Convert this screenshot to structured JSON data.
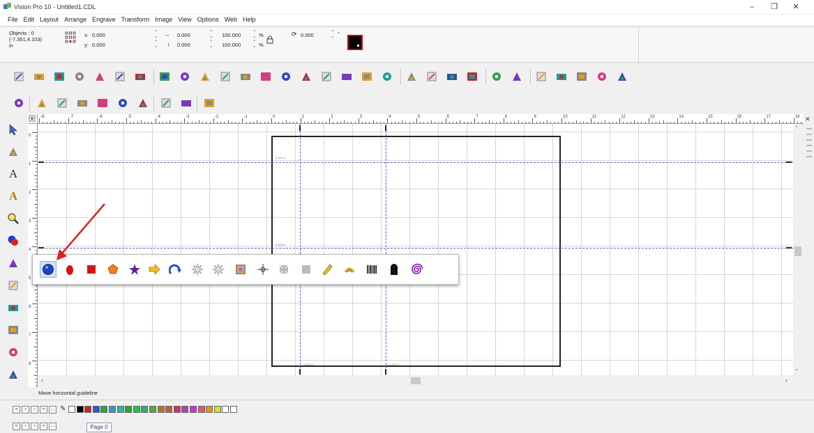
{
  "window": {
    "title": "Vision Pro 10 - Untitled1.CDL",
    "minimize": "–",
    "restore": "❐",
    "close": "✕"
  },
  "menu": [
    "File",
    "Edit",
    "Layout",
    "Arrange",
    "Engrave",
    "Transform",
    "Image",
    "View",
    "Options",
    "Web",
    "Help"
  ],
  "properties": {
    "objects_label": "Objects : 0",
    "cursor_pos": "(-7.351,4.103)",
    "units": "in",
    "x_label": "x:",
    "x_value": "0.000",
    "y_label": "y:",
    "y_value": "0.000",
    "width_value": "0.000",
    "height_value": "0.000",
    "scale_w": "100.000",
    "scale_h": "100.000",
    "pct": "%",
    "rotation": "0.000",
    "deg": "°",
    "color_accent": "#cc0000"
  },
  "toolbar1_icons": [
    "new-icon",
    "open-icon",
    "save-icon",
    "print-setup-icon",
    "print-icon",
    "engrave-icon",
    "output-icon",
    "undo-icon",
    "redo-icon",
    "node-icon",
    "import-icon",
    "job-icon",
    "image-icon",
    "window-icon",
    "mirror-icon",
    "mirror2-icon",
    "align-icon",
    "group-icon",
    "texture-icon",
    "layer-icon",
    "circle-icon",
    "text-ab-icon",
    "text-path-icon",
    "frame-icon",
    "delete-icon",
    "tool1-icon",
    "tool2-icon",
    "edit-icon",
    "screen-icon",
    "move-icon"
  ],
  "toolbar2_icons": [
    "cut-layer-icon",
    "v1-icon",
    "v2-icon",
    "v3-icon",
    "v4-icon",
    "target-icon",
    "download-icon",
    "layer-up-icon",
    "layer-down-icon",
    "engraver-icon"
  ],
  "toolbox_icons": [
    "select-arrow-icon",
    "engraver-tool-icon",
    "text-icon",
    "text-style-icon",
    "zoom-icon",
    "shapes-icon",
    "fill-icon",
    "pen-icon",
    "brush-icon",
    "pen2-icon",
    "engraving-tool-icon",
    "eraser-icon"
  ],
  "hruler_labels": [
    "-8",
    "-7",
    "-6",
    "-5",
    "-4",
    "-3",
    "-2",
    "-1",
    "0",
    "1",
    "2",
    "3",
    "4",
    "5",
    "6",
    "7",
    "8",
    "9",
    "10",
    "11",
    "12",
    "13",
    "14",
    "15",
    "16",
    "17",
    "18"
  ],
  "vruler_labels": [
    "0",
    "1",
    "2",
    "3",
    "4",
    "5",
    "6",
    "7",
    "8"
  ],
  "guides": {
    "label_top": "6.921 in",
    "label_mid": "3.906 in",
    "label_bottom_left": "1.000 in",
    "label_bottom_right": "4.000 in"
  },
  "flyout_icons": [
    "ellipse-icon",
    "egg-icon",
    "rectangle-icon",
    "pentagon-icon",
    "star-icon",
    "arrow-right-icon",
    "arc-arrow-icon",
    "starburst-icon",
    "starburst2-icon",
    "picture-frame-icon",
    "crosshair-icon",
    "placeholder-icon",
    "square-gray-icon",
    "ruler-icon",
    "arch-text-icon",
    "barcode-icon",
    "tombstone-icon",
    "spiral-icon"
  ],
  "status_text": "Move horizontal guideline",
  "page_tab": "Page 0",
  "nav_buttons": [
    "«",
    "‹",
    "›",
    "»",
    "…"
  ],
  "palette_colors": [
    "#ffffff",
    "#000000",
    "#cc2222",
    "#3355cc",
    "#22aa44",
    "#3399cc",
    "#22bbaa",
    "#22aa22",
    "#11cc33",
    "#33aa77",
    "#55aa33",
    "#aa7733",
    "#bb6633",
    "#cc3366",
    "#aa44aa",
    "#cc33cc",
    "#dd5577",
    "#dd9922",
    "#dddd33",
    "#ffffff",
    "#ffffff"
  ]
}
